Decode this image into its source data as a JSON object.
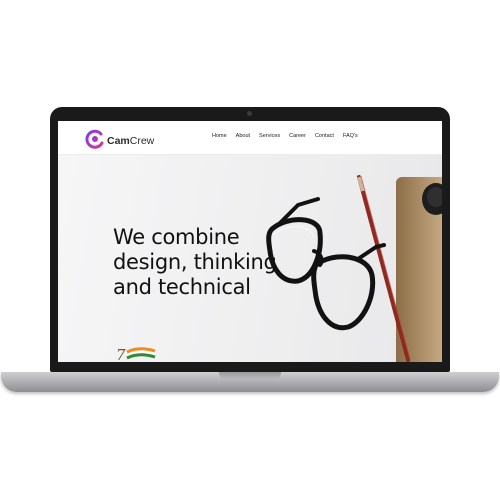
{
  "site": {
    "logo_part1": "Cam",
    "logo_part2": "Crew",
    "nav": [
      "Home",
      "About",
      "Services",
      "Career",
      "Contact",
      "FAQ's"
    ]
  },
  "hero": {
    "line1": "We combine",
    "line2": "design, thinking",
    "line3": "and technical"
  },
  "colors": {
    "logo_gradient_start": "#7b3fe4",
    "logo_gradient_end": "#e0338f",
    "laptop_bezel": "#1a1a1a",
    "pencil": "#9b2d22",
    "notebook": "#d4a46a"
  },
  "icons": {
    "logo": "camcrew-logo-icon",
    "badge": "india-75-badge"
  }
}
